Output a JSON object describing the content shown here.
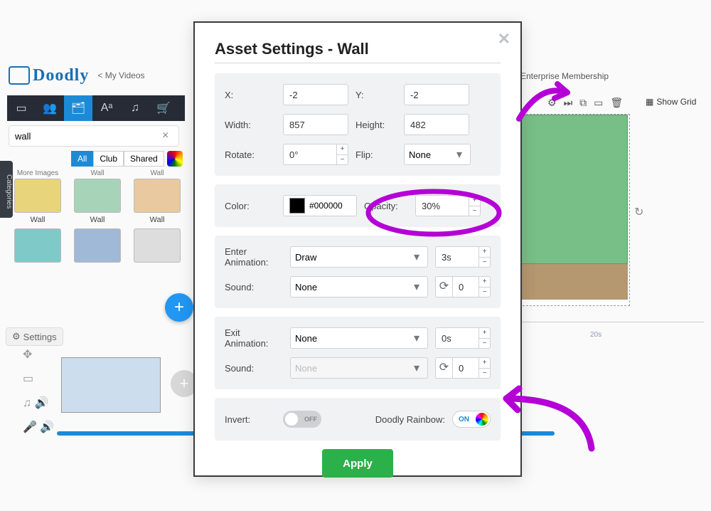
{
  "header": {
    "logo_text": "Doodly",
    "my_videos": "< My Videos",
    "membership": "Enterprise Membership"
  },
  "tabs": {
    "t0": "image-icon",
    "t1": "people-icon",
    "t2": "props-icon",
    "t3": "text-icon",
    "t4": "audio-icon",
    "t5": "cart-icon"
  },
  "search": {
    "value": "wall",
    "clear": "×"
  },
  "filters": {
    "all": "All",
    "club": "Club",
    "shared": "Shared"
  },
  "categories": "Categories",
  "grid": {
    "labels": [
      "More Images",
      "Wall",
      "Wall",
      "Wall",
      "Wall",
      "Wall"
    ],
    "row_label": "Wall"
  },
  "settings_link": "Settings",
  "canvas": {
    "show_grid": "Show Grid",
    "ruler_label": "20s"
  },
  "modal": {
    "title": "Asset Settings - Wall",
    "x_label": "X:",
    "x_val": "-2",
    "y_label": "Y:",
    "y_val": "-2",
    "w_label": "Width:",
    "w_val": "857",
    "h_label": "Height:",
    "h_val": "482",
    "rot_label": "Rotate:",
    "rot_val": "0°",
    "flip_label": "Flip:",
    "flip_val": "None",
    "color_label": "Color:",
    "color_val": "#000000",
    "op_label": "Opacity:",
    "op_val": "30%",
    "enter_label": "Enter Animation:",
    "enter_val": "Draw",
    "enter_dur": "3s",
    "sound_label": "Sound:",
    "sound_val": "None",
    "sound_count": "0",
    "exit_label": "Exit Animation:",
    "exit_val": "None",
    "exit_dur": "0s",
    "exit_sound_label": "Sound:",
    "exit_sound_val": "None",
    "exit_sound_count": "0",
    "invert_label": "Invert:",
    "invert_state": "OFF",
    "rainbow_label": "Doodly Rainbow:",
    "rainbow_state": "ON",
    "apply": "Apply"
  }
}
